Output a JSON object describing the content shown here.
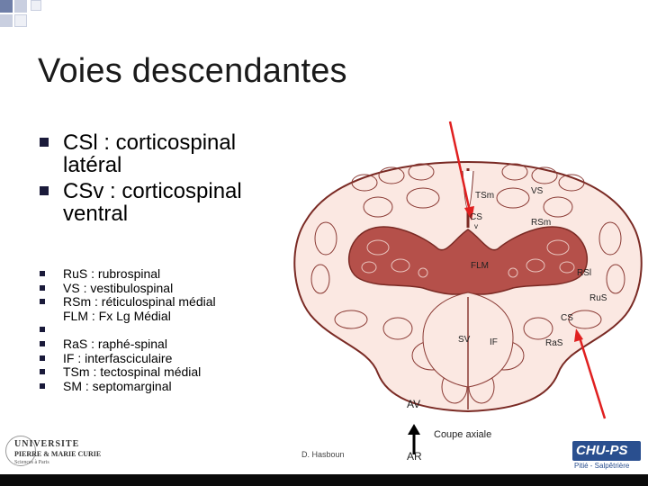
{
  "slide": {
    "title": "Voies descendantes",
    "main_bullets": [
      {
        "line1": "CSl : corticospinal",
        "line2": "latéral"
      },
      {
        "line1": "CSv : corticospinal",
        "line2": "ventral"
      }
    ],
    "abbrev_bullets": [
      {
        "bullet": true,
        "text": "RuS : rubrospinal"
      },
      {
        "bullet": true,
        "text": "VS : vestibulospinal"
      },
      {
        "bullet": true,
        "text": "RSm : réticulospinal médial"
      },
      {
        "bullet": false,
        "text": "FLM : Fx Lg Médial"
      },
      {
        "bullet": true,
        "text": ""
      },
      {
        "bullet": true,
        "text": "RaS : raphé-spinal"
      },
      {
        "bullet": true,
        "text": "IF : interfasciculaire"
      },
      {
        "bullet": true,
        "text": "TSm : tectospinal médial"
      },
      {
        "bullet": true,
        "text": "SM : septomarginal"
      }
    ]
  },
  "figure": {
    "labels": {
      "vs": "VS",
      "tsm": "TSm",
      "cs_top": "CS",
      "v": "v",
      "rsm": "RSm",
      "flm": "FLM",
      "rsl": "RSl",
      "rus": "RuS",
      "cs_right": "CS",
      "sv": "SV",
      "if": "IF",
      "ras": "RaS"
    },
    "av_label": "AV",
    "ar_label": "AR",
    "caption": "Coupe axiale",
    "author": "D. Hasboun",
    "colors": {
      "gray_matter": "#b5504a",
      "white_matter": "#fbe8e2",
      "outline": "#7a2a24",
      "arrow": "#e02020"
    }
  },
  "logos": {
    "university": {
      "line1": "UNIVERSITE",
      "line2": "PIERRE & MARIE CURIE",
      "line3": "Sciences à Paris"
    },
    "hospital": {
      "name": "CHU-PS",
      "subtitle": "Pitié - Salpêtrière"
    }
  }
}
